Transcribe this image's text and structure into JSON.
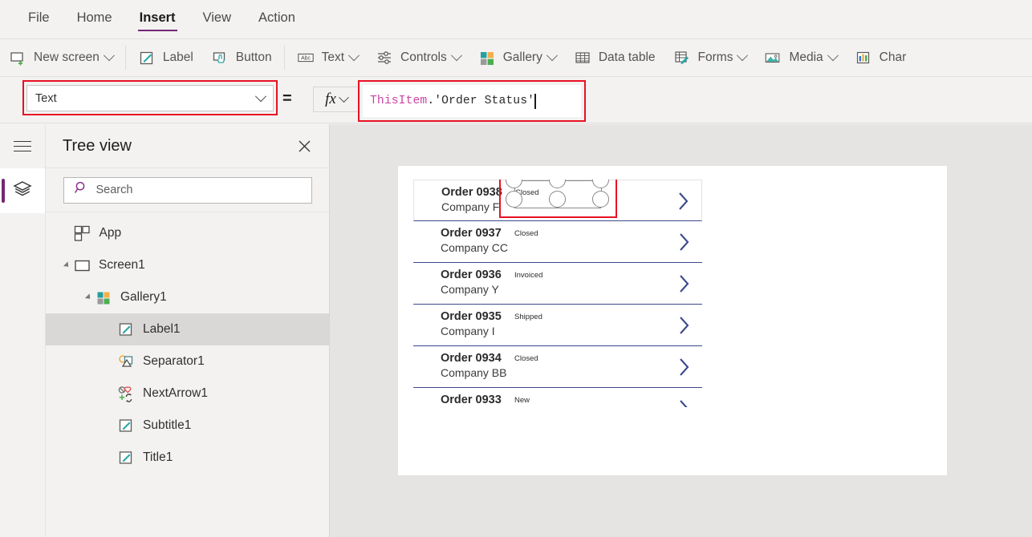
{
  "menubar": {
    "items": [
      {
        "label": "File",
        "active": false
      },
      {
        "label": "Home",
        "active": false
      },
      {
        "label": "Insert",
        "active": true
      },
      {
        "label": "View",
        "active": false
      },
      {
        "label": "Action",
        "active": false
      }
    ]
  },
  "ribbon": {
    "items": [
      {
        "label": "New screen",
        "icon": "new-screen-icon",
        "caret": true
      },
      {
        "label": "Label",
        "icon": "label-icon",
        "caret": false
      },
      {
        "label": "Button",
        "icon": "button-icon",
        "caret": false
      },
      {
        "label": "Text",
        "icon": "text-abc-icon",
        "caret": true
      },
      {
        "label": "Controls",
        "icon": "controls-icon",
        "caret": true
      },
      {
        "label": "Gallery",
        "icon": "gallery-icon",
        "caret": true
      },
      {
        "label": "Data table",
        "icon": "data-table-icon",
        "caret": false
      },
      {
        "label": "Forms",
        "icon": "forms-icon",
        "caret": true
      },
      {
        "label": "Media",
        "icon": "media-icon",
        "caret": true
      },
      {
        "label": "Char",
        "icon": "charts-icon",
        "caret": false
      }
    ]
  },
  "formula_bar": {
    "property_value": "Text",
    "equals_sign": "=",
    "fx_label": "fx",
    "formula_identifier": "ThisItem",
    "formula_rest": ".'Order Status'",
    "formula_full": "ThisItem.'Order Status'",
    "highlight_color": "#e81123",
    "identifier_color": "#cc43a3"
  },
  "tree_view": {
    "title": "Tree view",
    "close_icon": "close-icon",
    "search_placeholder": "Search",
    "search_value": "",
    "items": [
      {
        "label": "App",
        "icon": "app-icon",
        "depth": 0,
        "expander": "none",
        "selected": false
      },
      {
        "label": "Screen1",
        "icon": "screen-icon",
        "depth": 0,
        "expander": "expanded",
        "selected": false
      },
      {
        "label": "Gallery1",
        "icon": "gallery-icon",
        "depth": 1,
        "expander": "expanded",
        "selected": false
      },
      {
        "label": "Label1",
        "icon": "label-icon",
        "depth": 2,
        "expander": "none",
        "selected": true
      },
      {
        "label": "Separator1",
        "icon": "separator-icon",
        "depth": 2,
        "expander": "none",
        "selected": false
      },
      {
        "label": "NextArrow1",
        "icon": "next-arrow-icon",
        "depth": 2,
        "expander": "none",
        "selected": false
      },
      {
        "label": "Subtitle1",
        "icon": "label-icon",
        "depth": 2,
        "expander": "none",
        "selected": false
      },
      {
        "label": "Title1",
        "icon": "label-icon",
        "depth": 2,
        "expander": "none",
        "selected": false
      }
    ]
  },
  "canvas": {
    "accent_color": "#3b4a8c",
    "gallery_rows": [
      {
        "title": "Order 0938",
        "subtitle": "Company F",
        "status": "Closed",
        "chevron": "full",
        "hovered": true,
        "selected_label": true
      },
      {
        "title": "Order 0937",
        "subtitle": "Company CC",
        "status": "Closed",
        "chevron": "full",
        "hovered": false,
        "selected_label": false
      },
      {
        "title": "Order 0936",
        "subtitle": "Company Y",
        "status": "Invoiced",
        "chevron": "full",
        "hovered": false,
        "selected_label": false
      },
      {
        "title": "Order 0935",
        "subtitle": "Company I",
        "status": "Shipped",
        "chevron": "full",
        "hovered": false,
        "selected_label": false
      },
      {
        "title": "Order 0934",
        "subtitle": "Company BB",
        "status": "Closed",
        "chevron": "full",
        "hovered": false,
        "selected_label": false
      },
      {
        "title": "Order 0933",
        "subtitle": "",
        "status": "New",
        "chevron": "clipped",
        "hovered": false,
        "selected_label": false
      }
    ]
  }
}
